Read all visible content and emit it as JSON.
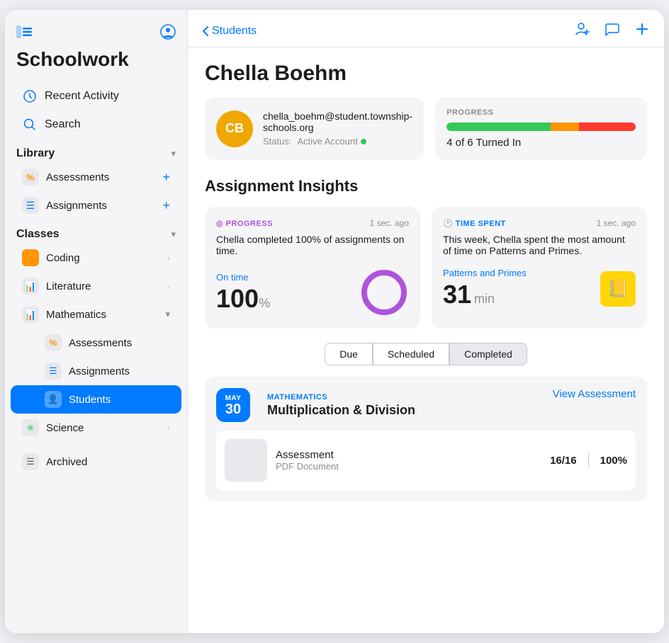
{
  "app": {
    "title": "Schoolwork",
    "sidebar_toggle_icon": "⊞",
    "profile_icon": "👤"
  },
  "sidebar": {
    "nav_items": [
      {
        "id": "recent-activity",
        "label": "Recent Activity",
        "icon": "🕐"
      },
      {
        "id": "search",
        "label": "Search",
        "icon": "🔍"
      }
    ],
    "library": {
      "title": "Library",
      "items": [
        {
          "id": "assessments",
          "label": "Assessments",
          "icon": "%"
        },
        {
          "id": "assignments",
          "label": "Assignments",
          "icon": "📋"
        }
      ]
    },
    "classes": {
      "title": "Classes",
      "items": [
        {
          "id": "coding",
          "label": "Coding",
          "icon": "🟧",
          "has_chevron": true
        },
        {
          "id": "literature",
          "label": "Literature",
          "icon": "📊",
          "has_chevron": true
        },
        {
          "id": "mathematics",
          "label": "Mathematics",
          "icon": "📊",
          "has_chevron": true,
          "sub_items": [
            {
              "id": "math-assessments",
              "label": "Assessments",
              "icon": "%"
            },
            {
              "id": "math-assignments",
              "label": "Assignments",
              "icon": "📋"
            },
            {
              "id": "math-students",
              "label": "Students",
              "icon": "📋",
              "active": true
            }
          ]
        },
        {
          "id": "science",
          "label": "Science",
          "icon": "✳",
          "has_chevron": true
        }
      ]
    },
    "archived": {
      "label": "Archived",
      "icon": "📋"
    }
  },
  "header": {
    "back_label": "Students",
    "actions": {
      "add_student": "add-student-icon",
      "message": "message-icon",
      "add": "add-icon"
    }
  },
  "student": {
    "name": "Chella Boehm",
    "initials": "CB",
    "avatar_color": "#f0a800",
    "email": "chella_boehm@student.township-schools.org",
    "status_label": "Status:",
    "status_value": "Active Account"
  },
  "progress": {
    "label": "PROGRESS",
    "value": "4 of 6 Turned In",
    "green_pct": 55,
    "orange_pct": 15,
    "red_pct": 30
  },
  "insights": {
    "title": "Assignment Insights",
    "progress_card": {
      "type_label": "PROGRESS",
      "timestamp": "1 sec. ago",
      "description": "Chella completed 100% of assignments on time.",
      "metric_label": "On time",
      "metric_value": "100",
      "metric_unit": "%"
    },
    "time_card": {
      "type_label": "TIME SPENT",
      "timestamp": "1 sec. ago",
      "description": "This week, Chella spent the most amount of time on Patterns and Primes.",
      "subject": "Patterns and Primes",
      "metric_value": "31",
      "metric_unit": "min"
    }
  },
  "tabs": {
    "items": [
      {
        "id": "due",
        "label": "Due"
      },
      {
        "id": "scheduled",
        "label": "Scheduled"
      },
      {
        "id": "completed",
        "label": "Completed",
        "active": true
      }
    ]
  },
  "assignment": {
    "month": "MAY",
    "day": "30",
    "subject": "MATHEMATICS",
    "title": "Multiplication & Division",
    "view_btn_label": "View Assessment",
    "item_name": "Assessment",
    "item_type": "PDF Document",
    "score_fraction": "16/16",
    "score_pct": "100%"
  }
}
